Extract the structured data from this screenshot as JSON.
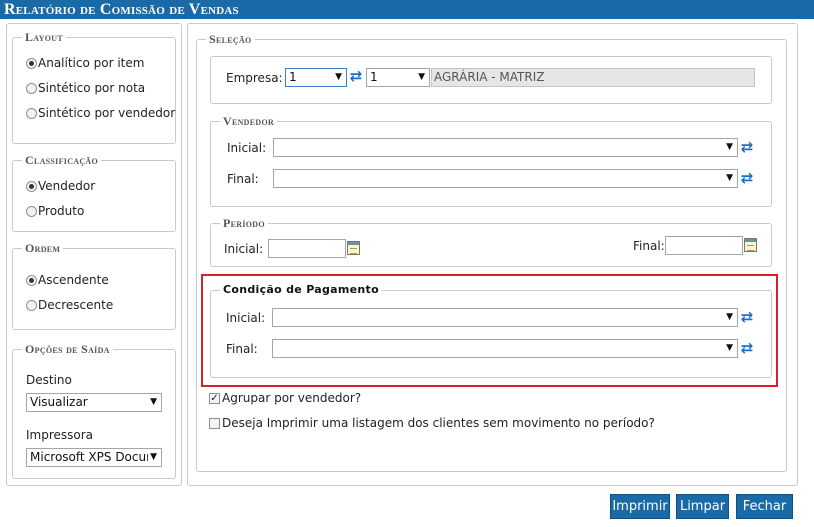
{
  "window": {
    "title": "Relatório de Comissão de Vendas"
  },
  "layout": {
    "legend": "Layout",
    "options": [
      {
        "label": "Analítico por item",
        "selected": true
      },
      {
        "label": "Sintético por nota",
        "selected": false
      },
      {
        "label": "Sintético por vendedor",
        "selected": false
      }
    ]
  },
  "classificacao": {
    "legend": "Classificação",
    "options": [
      {
        "label": "Vendedor",
        "selected": true
      },
      {
        "label": "Produto",
        "selected": false
      }
    ]
  },
  "ordem": {
    "legend": "Ordem",
    "options": [
      {
        "label": "Ascendente",
        "selected": true
      },
      {
        "label": "Decrescente",
        "selected": false
      }
    ]
  },
  "saida": {
    "legend": "Opções de Saída",
    "destino_label": "Destino",
    "destino_value": "Visualizar",
    "impressora_label": "Impressora",
    "impressora_value": "Microsoft XPS Docum"
  },
  "selecao": {
    "legend": "Seleção",
    "empresa_label": "Empresa:",
    "empresa_value": "1",
    "empresa_code": "1",
    "empresa_name": "AGRÁRIA - MATRIZ"
  },
  "vendedor": {
    "legend": "Vendedor",
    "inicial_label": "Inicial:",
    "final_label": "Final:"
  },
  "periodo": {
    "legend": "Período",
    "inicial_label": "Inicial:",
    "final_label": "Final:"
  },
  "pagamento": {
    "legend": "Condição de Pagamento",
    "inicial_label": "Inicial:",
    "final_label": "Final:"
  },
  "checks": {
    "agrupar_label": "Agrupar por vendedor?",
    "agrupar_checked": true,
    "listagem_label": "Deseja Imprimir uma listagem dos clientes sem movimento no período?",
    "listagem_checked": false
  },
  "buttons": {
    "imprimir": "Imprimir",
    "limpar": "Limpar",
    "fechar": "Fechar"
  },
  "colors": {
    "brand": "#1b6aa8",
    "highlight": "#d8202a",
    "refresh_icon": "#1f6fc0"
  }
}
